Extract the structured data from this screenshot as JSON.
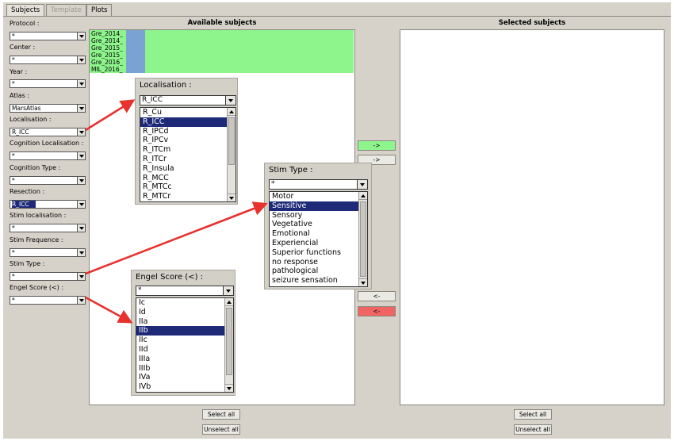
{
  "tabs": [
    {
      "label": "Subjects"
    },
    {
      "label": "Template"
    },
    {
      "label": "Plots"
    }
  ],
  "filters": [
    {
      "label": "Protocol :",
      "value": "*"
    },
    {
      "label": "Center :",
      "value": "*"
    },
    {
      "label": "Year :",
      "value": "*"
    },
    {
      "label": "Atlas :",
      "value": "MarsAtlas"
    },
    {
      "label": "Localisation :",
      "value": "R_ICC"
    },
    {
      "label": "Cognition Localisation :",
      "value": "*"
    },
    {
      "label": "Cognition Type :",
      "value": "*"
    },
    {
      "label": "Resection :",
      "value": "R_ICC"
    },
    {
      "label": "Stim localisation :",
      "value": "*"
    },
    {
      "label": "Stim Frequence :",
      "value": "*"
    },
    {
      "label": "Stim Type :",
      "value": "*"
    },
    {
      "label": "Engel Score (<) :",
      "value": "*"
    }
  ],
  "available": {
    "header": "Available subjects",
    "items": [
      "Gre_2014_",
      "Gre_2014_",
      "Gre_2015_",
      "Gre_2015_",
      "Gre_2016_",
      "MIL_2016_"
    ]
  },
  "selected": {
    "header": "Selected subjects"
  },
  "transfer_buttons": {
    "add_selected": "->",
    "add_all": "->",
    "remove_selected": "<-",
    "remove_all": "<-"
  },
  "bottom_buttons": {
    "select_all": "Select all",
    "unselect_all": "Unselect all"
  },
  "localisation_popup": {
    "title": "Localisation :",
    "value": "R_ICC",
    "items": [
      "R_Cu",
      "R_ICC",
      "R_IPCd",
      "R_IPCv",
      "R_ITCm",
      "R_ITCr",
      "R_Insula",
      "R_MCC",
      "R_MTCc",
      "R_MTCr"
    ],
    "selected": "R_ICC"
  },
  "stimtype_popup": {
    "title": "Stim Type :",
    "value": "*",
    "items": [
      "Motor",
      "Sensitive",
      "Sensory",
      "Vegetative",
      "Emotional",
      "Experiencial",
      "Superior functions",
      "no response",
      "pathological",
      "seizure sensation"
    ],
    "selected": "Sensitive"
  },
  "engel_popup": {
    "title": "Engel Score (<) :",
    "value": "*",
    "items": [
      "Ic",
      "Id",
      "IIa",
      "IIb",
      "IIc",
      "IId",
      "IIIa",
      "IIIb",
      "IVa",
      "IVb"
    ],
    "selected": "IIb"
  },
  "colors": {
    "panel": "#d6d2ca",
    "green": "#8ef58c",
    "red": "#f06464",
    "selection": "#1e2a78",
    "arrow": "#e8322e"
  }
}
